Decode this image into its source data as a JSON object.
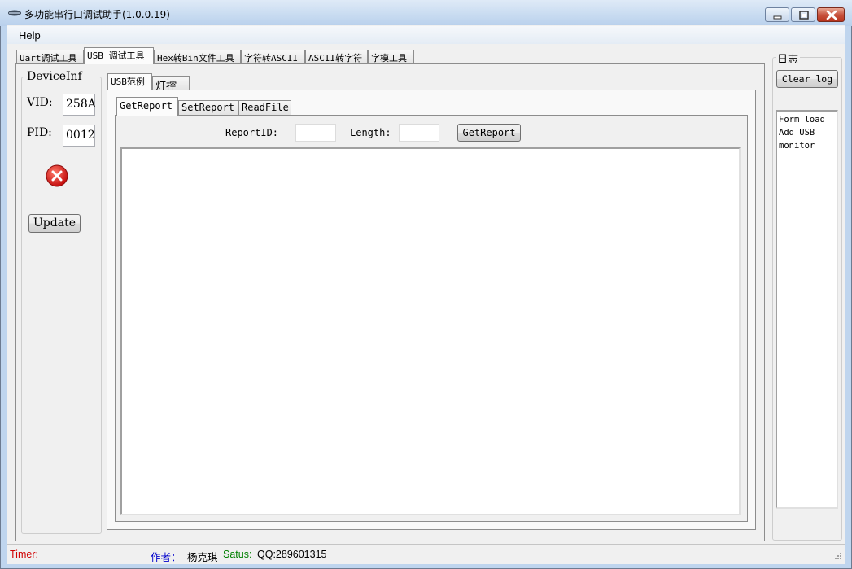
{
  "window": {
    "title": "多功能串行口调试助手(1.0.0.19)",
    "minimize_icon": "minimize-icon",
    "maximize_icon": "maximize-icon",
    "close_icon": "close-icon"
  },
  "menu": {
    "items": [
      {
        "label": "Help"
      }
    ]
  },
  "main_tabs": [
    {
      "label": "Uart调试工具",
      "active": false
    },
    {
      "label": "USB 调试工具",
      "active": true
    },
    {
      "label": "Hex转Bin文件工具",
      "active": false
    },
    {
      "label": "字符转ASCII",
      "active": false
    },
    {
      "label": "ASCII转字符",
      "active": false
    },
    {
      "label": "字模工具",
      "active": false
    }
  ],
  "device_info": {
    "title": "DeviceInf",
    "vid_label": "VID:",
    "vid_value": "258A",
    "pid_label": "PID:",
    "pid_value": "0012",
    "status_icon": "error-x-icon",
    "update_button": "Update"
  },
  "sub_tabs": [
    {
      "label": "USB范例",
      "active": true
    },
    {
      "label": "灯控",
      "active": false
    }
  ],
  "report_tabs": [
    {
      "label": "GetReport",
      "active": true
    },
    {
      "label": "SetReport",
      "active": false
    },
    {
      "label": "ReadFile",
      "active": false
    }
  ],
  "get_report": {
    "report_id_label": "ReportID:",
    "report_id_value": "",
    "length_label": "Length:",
    "length_value": "",
    "button": "GetReport",
    "output": ""
  },
  "log": {
    "title": "日志",
    "clear_button": "Clear log",
    "lines": [
      "Form load",
      "Add USB",
      "monitor"
    ]
  },
  "status": {
    "timer_label": "Timer:",
    "author_label": "作者：",
    "author_name": "杨克琪",
    "status_label": "Satus:",
    "status_value": "QQ:289601315",
    "colors": {
      "timer": "#d00000",
      "author": "#0000cc",
      "status": "#008000"
    }
  }
}
